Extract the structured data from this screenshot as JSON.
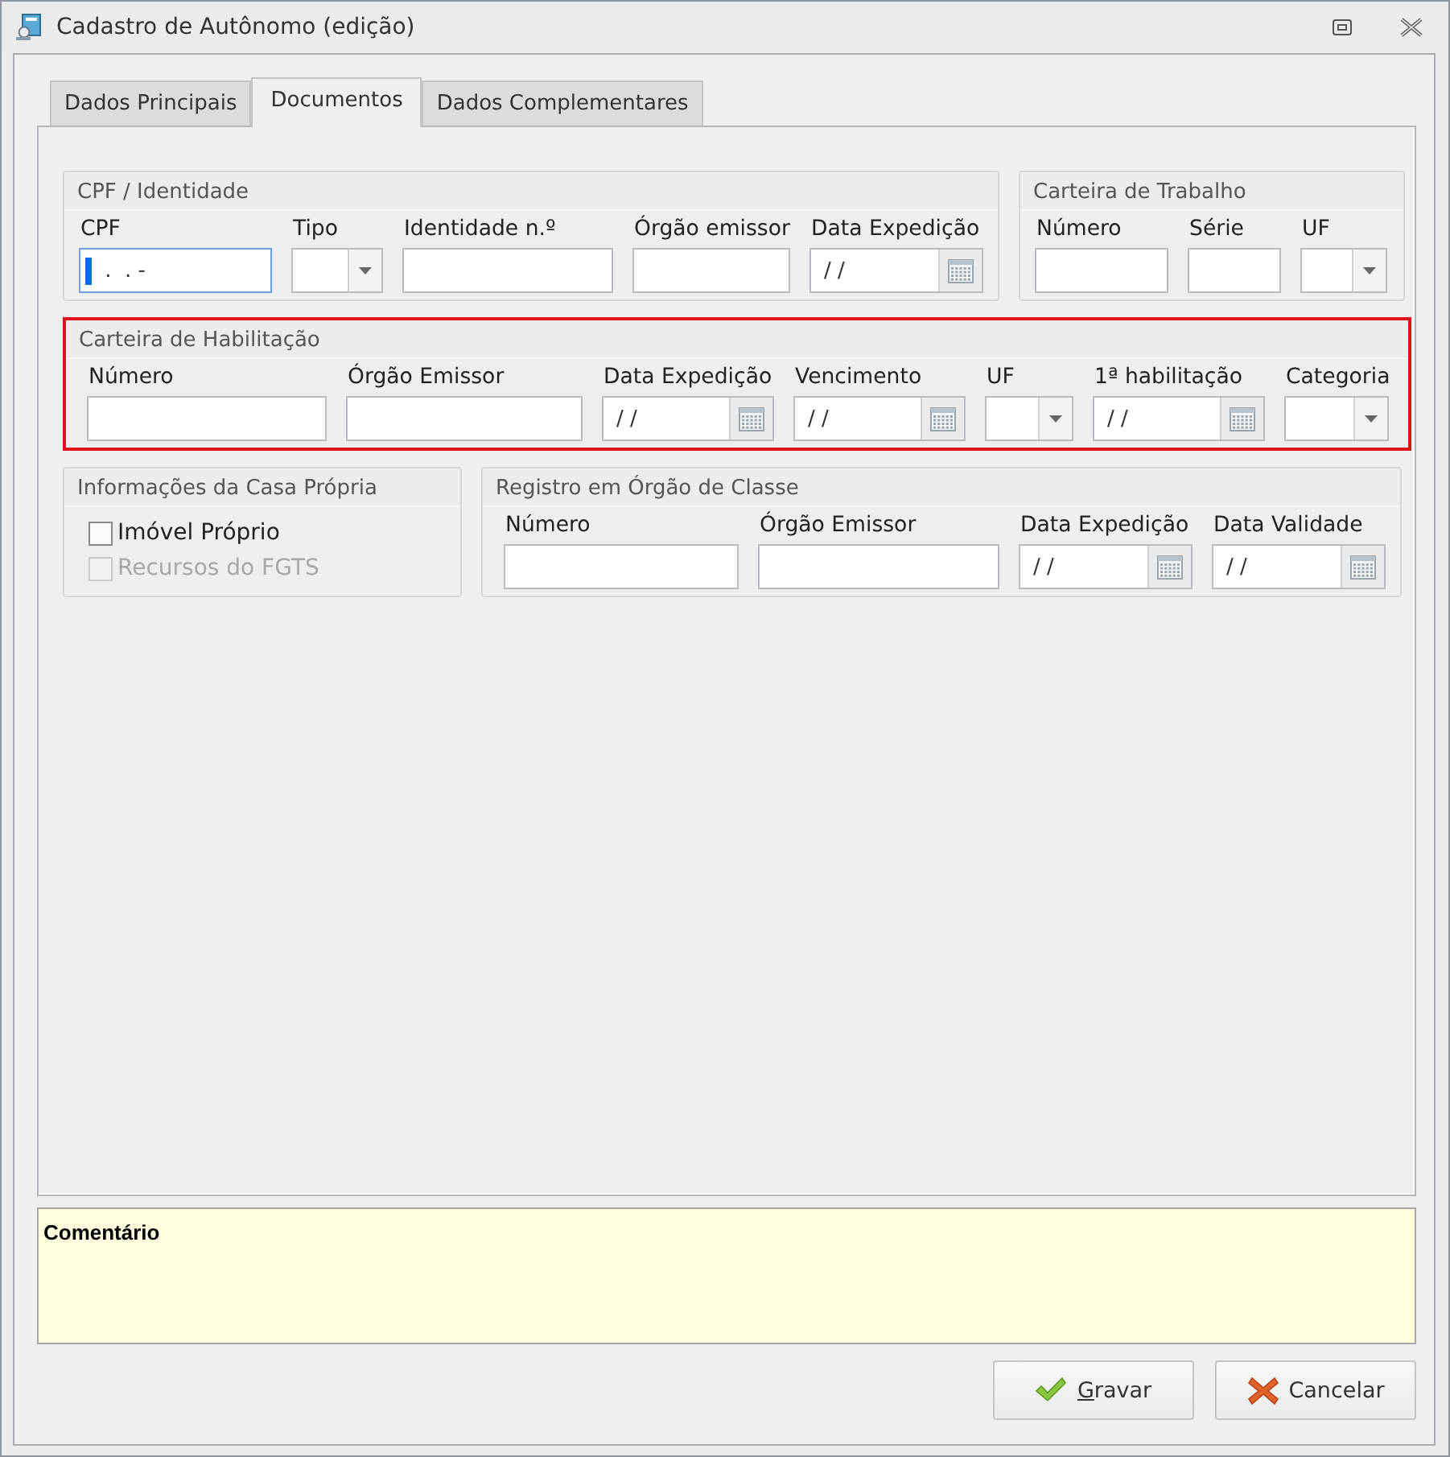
{
  "window": {
    "title": "Cadastro de Autônomo (edição)"
  },
  "tabs": [
    {
      "label": "Dados Principais",
      "selected": false
    },
    {
      "label": "Documentos",
      "selected": true
    },
    {
      "label": "Dados Complementares",
      "selected": false
    }
  ],
  "groups": [
    {
      "title": "CPF / Identidade",
      "highlighted": false,
      "fields": [
        {
          "label": "CPF",
          "kind": "text",
          "value": " .  . -",
          "focused": true
        },
        {
          "label": "Tipo",
          "kind": "combo",
          "focused": false
        },
        {
          "label": "Identidade n.º",
          "kind": "text",
          "focused": false
        },
        {
          "label": "Órgão emissor",
          "kind": "text",
          "focused": false
        },
        {
          "label": "Data Expedição",
          "kind": "date",
          "value": "/ /",
          "focused": false
        }
      ]
    },
    {
      "title": "Carteira de Trabalho",
      "highlighted": false,
      "fields": [
        {
          "label": "Número",
          "kind": "text",
          "focused": false
        },
        {
          "label": "Série",
          "kind": "text",
          "focused": false
        },
        {
          "label": "UF",
          "kind": "combo",
          "focused": false
        }
      ]
    },
    {
      "title": "Carteira de Habilitação",
      "highlighted": true,
      "fields": [
        {
          "label": "Número",
          "kind": "text",
          "focused": false
        },
        {
          "label": "Órgão Emissor",
          "kind": "text",
          "focused": false
        },
        {
          "label": "Data Expedição",
          "kind": "date",
          "value": "/ /",
          "focused": false
        },
        {
          "label": "Vencimento",
          "kind": "date",
          "value": "/ /",
          "focused": false
        },
        {
          "label": "UF",
          "kind": "combo",
          "focused": false
        },
        {
          "label": "1ª habilitação",
          "kind": "date",
          "value": "/ /",
          "focused": false
        },
        {
          "label": "Categoria",
          "kind": "combo",
          "focused": false
        }
      ]
    },
    {
      "title": "Informações da Casa Própria",
      "highlighted": false,
      "checkboxes": [
        {
          "label": "Imóvel Próprio",
          "checked": false,
          "disabled": false
        },
        {
          "label": "Recursos do FGTS",
          "checked": false,
          "disabled": true
        }
      ]
    },
    {
      "title": "Registro em Órgão de Classe",
      "highlighted": false,
      "fields": [
        {
          "label": "Número",
          "kind": "text",
          "focused": false
        },
        {
          "label": "Órgão Emissor",
          "kind": "text",
          "focused": false
        },
        {
          "label": "Data Expedição",
          "kind": "date",
          "value": "/ /",
          "focused": false
        },
        {
          "label": "Data Validade",
          "kind": "date",
          "value": "/ /",
          "focused": false
        }
      ]
    }
  ],
  "comment": {
    "label": "Comentário"
  },
  "buttons": [
    {
      "label": "Gravar",
      "kind": "confirm",
      "mnemonic_first": true
    },
    {
      "label": "Cancelar",
      "kind": "cancel",
      "mnemonic_first": false
    }
  ]
}
